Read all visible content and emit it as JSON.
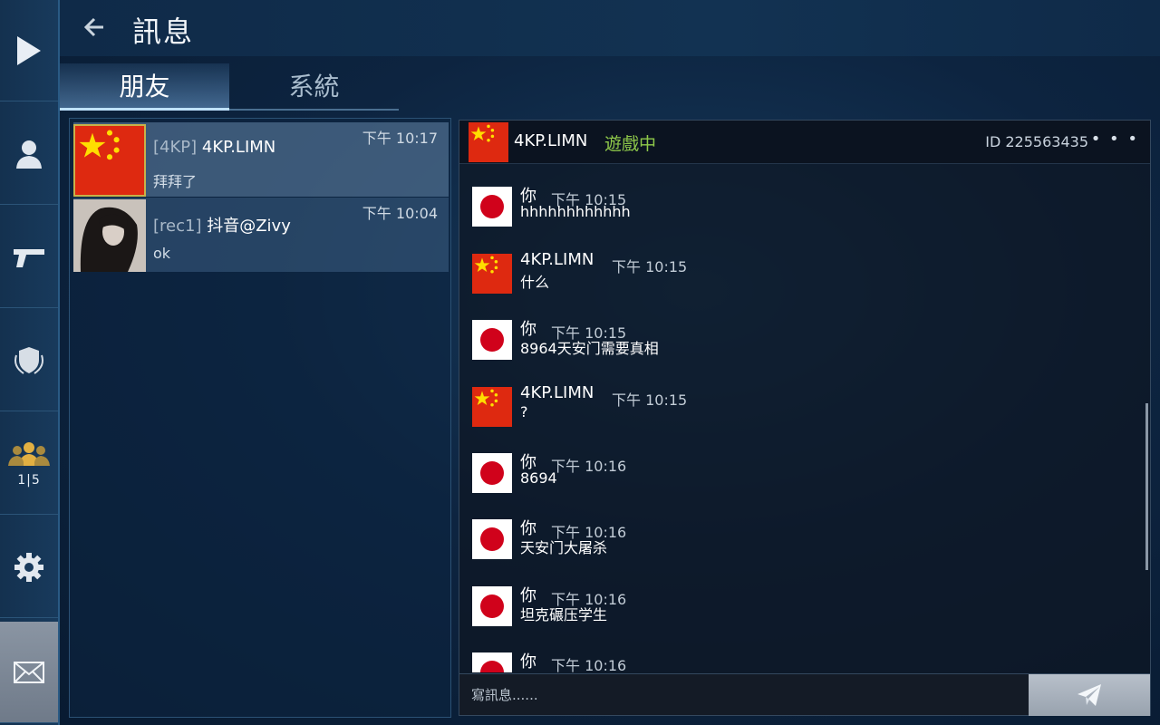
{
  "sidebar": {
    "items": [
      {
        "icon": "play-icon"
      },
      {
        "icon": "profile-icon"
      },
      {
        "icon": "pistol-icon"
      },
      {
        "icon": "clan-shield-icon"
      },
      {
        "icon": "friends-icon",
        "badge": "1|5"
      },
      {
        "icon": "gear-icon"
      },
      {
        "icon": "mail-icon"
      }
    ]
  },
  "header": {
    "title": "訊息",
    "back_icon": "back-arrow-icon"
  },
  "tabs": [
    {
      "label": "朋友",
      "active": true
    },
    {
      "label": "系統",
      "active": false
    }
  ],
  "friends": [
    {
      "clan": "[4KP]",
      "name": "4KP.LIMN",
      "time": "下午 10:17",
      "last_message": "拜拜了",
      "avatar": "china-flag",
      "selected": true
    },
    {
      "clan": "[rec1]",
      "name": "抖音@Zivy",
      "time": "下午 10:04",
      "last_message": "ok",
      "avatar": "photo-avatar",
      "selected": false
    }
  ],
  "chat": {
    "header": {
      "name": "4KP.LIMN",
      "status": "遊戲中",
      "id_label": "ID 225563435",
      "more": "• • •"
    },
    "messages": [
      {
        "sender": "你",
        "time": "下午 10:15",
        "text": "hhhhhhhhhhhh",
        "avatar": "japan-flag"
      },
      {
        "sender": "4KP.LIMN",
        "time": "下午 10:15",
        "text": "什么",
        "avatar": "china-flag"
      },
      {
        "sender": "你",
        "time": "下午 10:15",
        "text": "8964天安门需要真相",
        "avatar": "japan-flag"
      },
      {
        "sender": "4KP.LIMN",
        "time": "下午 10:15",
        "text": "?",
        "avatar": "china-flag"
      },
      {
        "sender": "你",
        "time": "下午 10:16",
        "text": "8694",
        "avatar": "japan-flag"
      },
      {
        "sender": "你",
        "time": "下午 10:16",
        "text": "天安门大屠杀",
        "avatar": "japan-flag"
      },
      {
        "sender": "你",
        "time": "下午 10:16",
        "text": "坦克碾压学生",
        "avatar": "japan-flag"
      },
      {
        "sender": "你",
        "time": "下午 10:16",
        "text": "",
        "avatar": "japan-flag"
      }
    ],
    "input_placeholder": "寫訊息......",
    "send_icon": "paper-plane-icon"
  },
  "colors": {
    "online_status": "#8fc94a",
    "selected_border": "#c8b24a",
    "tab_underline": "#bfe2ff"
  }
}
